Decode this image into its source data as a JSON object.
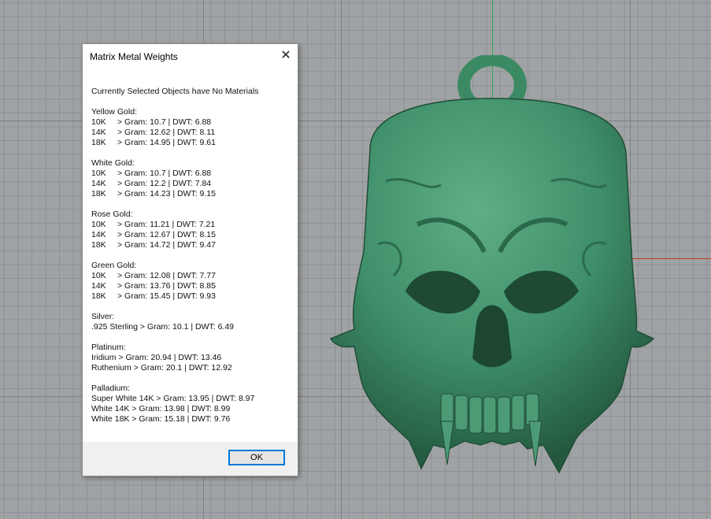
{
  "dialog": {
    "title": "Matrix Metal Weights",
    "close_glyph": "✕",
    "status": "Currently Selected Objects have No Materials",
    "groups": [
      {
        "title": "Yellow Gold:",
        "rows": [
          {
            "karat": "10K",
            "value": "> Gram: 10.7 | DWT: 6.88"
          },
          {
            "karat": "14K",
            "value": "> Gram: 12.62 | DWT: 8.11"
          },
          {
            "karat": "18K",
            "value": "> Gram: 14.95 | DWT: 9.61"
          }
        ]
      },
      {
        "title": "White Gold:",
        "rows": [
          {
            "karat": "10K",
            "value": "> Gram: 10.7 | DWT: 6.88"
          },
          {
            "karat": "14K",
            "value": "> Gram: 12.2 | DWT: 7.84"
          },
          {
            "karat": "18K",
            "value": "> Gram: 14.23 | DWT: 9.15"
          }
        ]
      },
      {
        "title": "Rose Gold:",
        "rows": [
          {
            "karat": "10K",
            "value": "> Gram: 11.21 | DWT: 7.21"
          },
          {
            "karat": "14K",
            "value": "> Gram: 12.67 | DWT: 8.15"
          },
          {
            "karat": "18K",
            "value": "> Gram: 14.72 | DWT: 9.47"
          }
        ]
      },
      {
        "title": "Green Gold:",
        "rows": [
          {
            "karat": "10K",
            "value": "> Gram: 12.08 | DWT: 7.77"
          },
          {
            "karat": "14K",
            "value": "> Gram: 13.76 | DWT: 8.85"
          },
          {
            "karat": "18K",
            "value": "> Gram: 15.45 | DWT: 9.93"
          }
        ]
      },
      {
        "title": "Silver:",
        "rows": [
          {
            "karat": "",
            "value": ".925 Sterling > Gram: 10.1 | DWT: 6.49"
          }
        ]
      },
      {
        "title": "Platinum:",
        "rows": [
          {
            "karat": "",
            "value": "Iridium > Gram: 20.94 | DWT: 13.46"
          },
          {
            "karat": "",
            "value": "Ruthenium > Gram: 20.1 | DWT: 12.92"
          }
        ]
      },
      {
        "title": "Palladium:",
        "rows": [
          {
            "karat": "",
            "value": "Super White 14K > Gram: 13.95 | DWT: 8.97"
          },
          {
            "karat": "",
            "value": "White 14K > Gram: 13.98 | DWT: 8.99"
          },
          {
            "karat": "",
            "value": "White 18K > Gram: 15.18 | DWT: 9.76"
          }
        ]
      }
    ],
    "ok_label": "OK"
  },
  "colors": {
    "viewport_bg": "#a0a3a5",
    "model": "#3f8f6a",
    "y_axis": "#2fa84a",
    "x_axis": "#c0392b",
    "ok_border": "#0078d7"
  }
}
